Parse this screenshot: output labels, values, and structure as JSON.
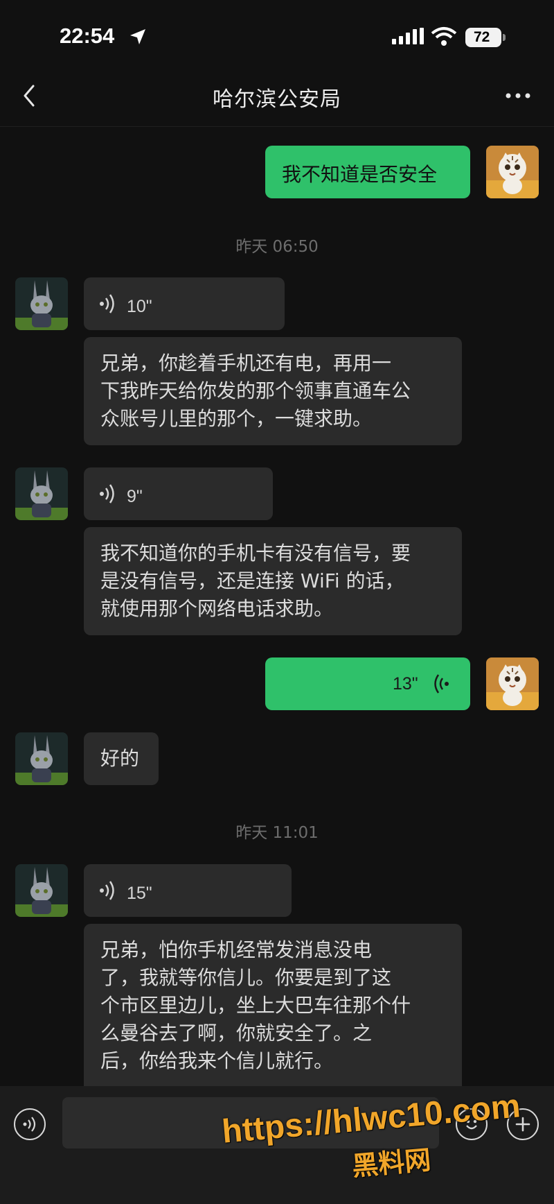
{
  "status_bar": {
    "time": "22:54",
    "battery": "72"
  },
  "header": {
    "title": "哈尔滨公安局"
  },
  "messages": [
    {
      "sender": "me",
      "type": "text",
      "text": "我不知道是否安全"
    },
    {
      "type": "timestamp",
      "text": "昨天 06:50"
    },
    {
      "sender": "contact",
      "type": "voice",
      "duration": "10\""
    },
    {
      "sender": "contact",
      "type": "text",
      "lines": [
        "兄弟，你趁着手机还有电，再用一",
        "下我昨天给你发的那个领事直通车公",
        "众账号儿里的那个，一键求助。"
      ]
    },
    {
      "sender": "contact",
      "type": "voice",
      "duration": "9\""
    },
    {
      "sender": "contact",
      "type": "text",
      "lines": [
        "我不知道你的手机卡有没有信号，要",
        "是没有信号，还是连接 WiFi 的话，",
        "就使用那个网络电话求助。"
      ]
    },
    {
      "sender": "me",
      "type": "voice",
      "duration": "13\""
    },
    {
      "sender": "contact",
      "type": "text",
      "text": "好的"
    },
    {
      "type": "timestamp",
      "text": "昨天 11:01"
    },
    {
      "sender": "contact",
      "type": "voice",
      "duration": "15\""
    },
    {
      "sender": "contact",
      "type": "text",
      "lines": [
        "兄弟，怕你手机经常发消息没电",
        "了，我就等你信儿。你要是到了这",
        "个市区里边儿，坐上大巴车往那个什",
        "么曼谷去了啊，你就安全了。之",
        "后，你给我来个信儿就行。"
      ]
    }
  ],
  "watermark": {
    "url": "https://hlwc10.com",
    "name": "黑料网"
  },
  "colors": {
    "background": "#111111",
    "incoming_bubble": "#2b2b2b",
    "outgoing_bubble": "#2fc16a",
    "watermark": "#f1a62a"
  },
  "icons": [
    "location-arrow-icon",
    "signal-icon",
    "wifi-icon",
    "back-icon",
    "more-icon",
    "voice-wave-icon",
    "voice-mode-icon",
    "emoji-icon",
    "plus-icon"
  ]
}
